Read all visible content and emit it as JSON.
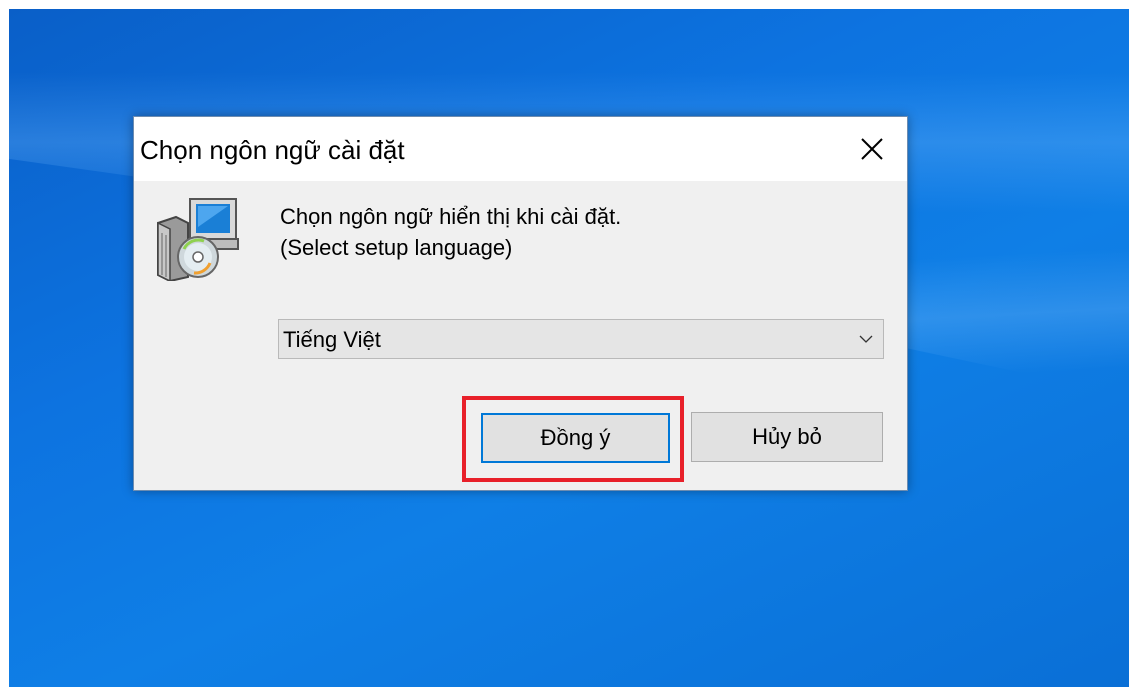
{
  "dialog": {
    "title": "Chọn ngôn ngữ cài đặt",
    "message_line1": "Chọn ngôn ngữ hiển thị khi cài đặt.",
    "message_line2": "(Select setup language)",
    "language_select": {
      "selected": "Tiếng Việt"
    },
    "ok_label": "Đồng ý",
    "cancel_label": "Hủy bỏ"
  },
  "icons": {
    "close": "close-icon",
    "setup": "setup-installer-icon",
    "dropdown": "chevron-down-icon"
  },
  "colors": {
    "desktop": "#0d73e0",
    "dialog_bg": "#f0f0f0",
    "focus_border": "#0078d7",
    "highlight": "#e8202a"
  }
}
